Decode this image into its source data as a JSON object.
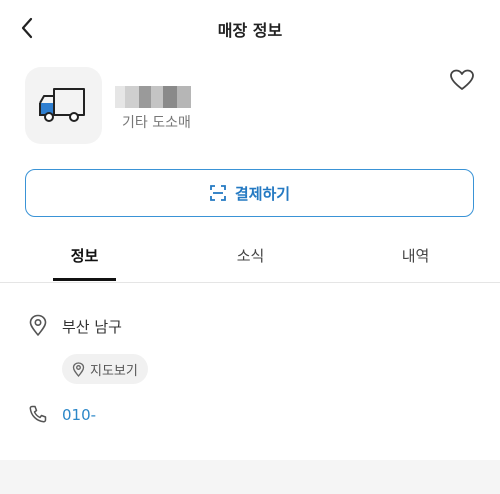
{
  "header": {
    "title": "매장 정보"
  },
  "store": {
    "category": "기타 도소매",
    "logo_icon": "truck-icon",
    "favorite_icon": "heart-icon"
  },
  "pay_button": {
    "label": "결제하기",
    "icon": "scan-icon"
  },
  "tabs": [
    {
      "label": "정보",
      "active": true
    },
    {
      "label": "소식",
      "active": false
    },
    {
      "label": "내역",
      "active": false
    }
  ],
  "info": {
    "address": "부산 남구",
    "map_button": "지도보기",
    "phone": "010-"
  },
  "colors": {
    "accent": "#2479c2",
    "border_accent": "#3a93d6",
    "phone": "#2b87c8"
  }
}
